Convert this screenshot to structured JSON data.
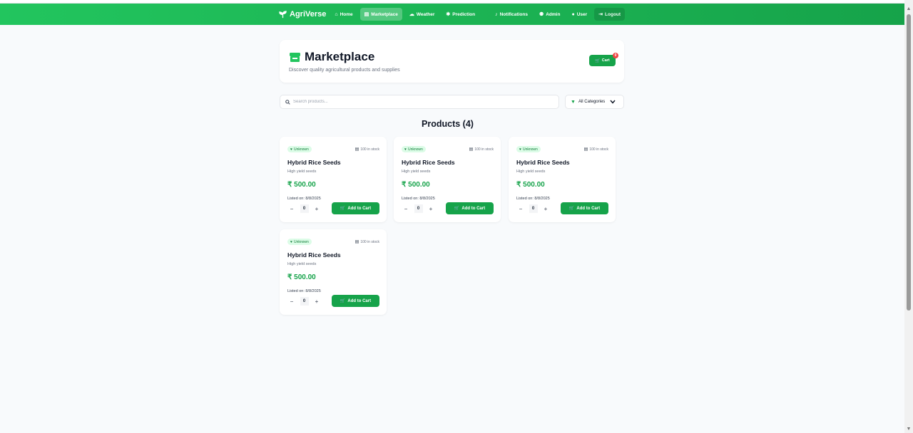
{
  "nav": {
    "brand": "AgriVerse",
    "items": [
      {
        "label": "Home",
        "icon": "home-icon",
        "glyph": "⌂"
      },
      {
        "label": "Marketplace",
        "icon": "store-icon",
        "glyph": "▤"
      },
      {
        "label": "Weather",
        "icon": "cloud-sun-icon",
        "glyph": "☁"
      },
      {
        "label": "Prediction",
        "icon": "brain-icon",
        "glyph": "✱"
      },
      {
        "label": "Notifications",
        "icon": "bell-icon",
        "glyph": "🔔"
      },
      {
        "label": "Admin",
        "icon": "user-shield-icon",
        "glyph": "👥"
      },
      {
        "label": "User",
        "icon": "user-icon",
        "glyph": "👤"
      },
      {
        "label": "Logout",
        "icon": "logout-icon",
        "glyph": "⏻"
      }
    ],
    "active": "Marketplace"
  },
  "header": {
    "title": "Marketplace",
    "subtitle": "Discover quality agricultural products and supplies",
    "cart_label": "Cart",
    "cart_count": "0"
  },
  "search": {
    "placeholder": "Search products...",
    "value": ""
  },
  "category_filter": {
    "selected": "All Categories"
  },
  "products_heading": "Products (4)",
  "products": [
    {
      "badge": "Unknown",
      "stock": "100 in stock",
      "name": "Hybrid Rice Seeds",
      "description": "High yield seeds",
      "price": "₹ 500.00",
      "listed": "Listed on: 8/8/2025",
      "quantity": "0",
      "add_label": "Add to Cart"
    },
    {
      "badge": "Unknown",
      "stock": "100 in stock",
      "name": "Hybrid Rice Seeds",
      "description": "High yield seeds",
      "price": "₹ 500.00",
      "listed": "Listed on: 8/8/2025",
      "quantity": "0",
      "add_label": "Add to Cart"
    },
    {
      "badge": "Unknown",
      "stock": "100 in stock",
      "name": "Hybrid Rice Seeds",
      "description": "High yield seeds",
      "price": "₹ 500.00",
      "listed": "Listed on: 8/8/2025",
      "quantity": "0",
      "add_label": "Add to Cart"
    },
    {
      "badge": "Unknown",
      "stock": "100 in stock",
      "name": "Hybrid Rice Seeds",
      "description": "High yield seeds",
      "price": "₹ 500.00",
      "listed": "Listed on: 8/8/2025",
      "quantity": "0",
      "add_label": "Add to Cart"
    }
  ],
  "colors": {
    "brand_green": "#16a34a",
    "badge_bg": "#dcfce7",
    "badge_text": "#15803d",
    "cart_badge": "#ef4444"
  }
}
